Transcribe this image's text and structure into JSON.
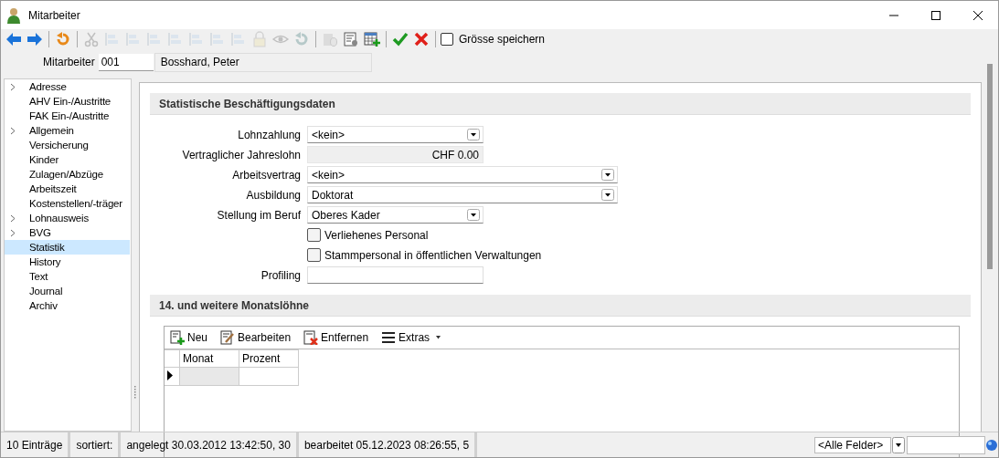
{
  "window": {
    "title": "Mitarbeiter"
  },
  "toolbar": [
    {
      "kind": "back",
      "disabled": false
    },
    {
      "kind": "forward",
      "disabled": false
    },
    {
      "kind": "undo",
      "disabled": false
    },
    {
      "kind": "cut",
      "disabled": true
    },
    {
      "kind": "align",
      "disabled": true
    },
    {
      "kind": "align",
      "disabled": true
    },
    {
      "kind": "align",
      "disabled": true
    },
    {
      "kind": "align",
      "disabled": true
    },
    {
      "kind": "align",
      "disabled": true
    },
    {
      "kind": "align",
      "disabled": true
    },
    {
      "kind": "align",
      "disabled": true
    },
    {
      "kind": "lock",
      "disabled": true
    },
    {
      "kind": "eye",
      "disabled": true
    },
    {
      "kind": "undo",
      "disabled": true
    },
    {
      "kind": "db",
      "disabled": true
    },
    {
      "kind": "form",
      "disabled": false
    },
    {
      "kind": "table",
      "disabled": false
    },
    {
      "kind": "ok",
      "disabled": false
    },
    {
      "kind": "cancel",
      "disabled": false
    }
  ],
  "save_size": {
    "label": "Grösse speichern",
    "checked": false
  },
  "employee": {
    "label": "Mitarbeiter",
    "number": "001",
    "name": "Bosshard, Peter"
  },
  "sidebar": {
    "items": [
      {
        "label": "Adresse",
        "kind": "folder",
        "selected": false
      },
      {
        "label": "AHV Ein-/Austritte",
        "kind": "leaf",
        "selected": false
      },
      {
        "label": "FAK Ein-/Austritte",
        "kind": "leaf",
        "selected": false
      },
      {
        "label": "Allgemein",
        "kind": "folder",
        "selected": false
      },
      {
        "label": "Versicherung",
        "kind": "leaf",
        "selected": false
      },
      {
        "label": "Kinder",
        "kind": "leaf",
        "selected": false
      },
      {
        "label": "Zulagen/Abzüge",
        "kind": "leaf",
        "selected": false
      },
      {
        "label": "Arbeitszeit",
        "kind": "leaf",
        "selected": false
      },
      {
        "label": "Kostenstellen/-träger",
        "kind": "leaf",
        "selected": false
      },
      {
        "label": "Lohnausweis",
        "kind": "folder",
        "selected": false
      },
      {
        "label": "BVG",
        "kind": "folder",
        "selected": false
      },
      {
        "label": "Statistik",
        "kind": "leaf",
        "selected": true
      },
      {
        "label": "History",
        "kind": "leaf",
        "selected": false
      },
      {
        "label": "Text",
        "kind": "leaf",
        "selected": false
      },
      {
        "label": "Journal",
        "kind": "leaf",
        "selected": false
      },
      {
        "label": "Archiv",
        "kind": "leaf",
        "selected": false
      }
    ]
  },
  "section1": {
    "title": "Statistische Beschäftigungsdaten",
    "fields": [
      {
        "kind": "dropdown",
        "label": "Lohnzahlung",
        "value": "<kein>",
        "wide": false
      },
      {
        "kind": "amount",
        "label": "Vertraglicher Jahreslohn",
        "value": "CHF 0.00",
        "wide": false
      },
      {
        "kind": "dropdown",
        "label": "Arbeitsvertrag",
        "value": "<kein>",
        "wide": true
      },
      {
        "kind": "dropdown",
        "label": "Ausbildung",
        "value": "Doktorat",
        "wide": true
      },
      {
        "kind": "dropdown",
        "label": "Stellung im Beruf",
        "value": "Oberes Kader",
        "wide": false
      },
      {
        "kind": "checkbox",
        "label": "Verliehenes Personal",
        "checked": false
      },
      {
        "kind": "checkbox",
        "label": "Stammpersonal in öffentlichen Verwaltungen",
        "checked": false
      },
      {
        "kind": "text",
        "label": "Profiling",
        "wide": false
      }
    ]
  },
  "section2": {
    "title": "14. und weitere Monatslöhne",
    "actions": [
      {
        "kind": "new",
        "label": "Neu"
      },
      {
        "kind": "edit",
        "label": "Bearbeiten"
      },
      {
        "kind": "remove",
        "label": "Entfernen"
      },
      {
        "kind": "menu",
        "label": "Extras"
      }
    ],
    "table": {
      "columns": [
        "Monat",
        "Prozent"
      ],
      "rows": [
        {
          "current": true
        }
      ]
    }
  },
  "status_bar": {
    "count": "10 Einträge",
    "sorted": "sortiert:",
    "created": "angelegt 30.03.2012 13:42:50, 30",
    "edited": "bearbeitet 05.12.2023 08:26:55,  5",
    "filter": "<Alle Felder>"
  }
}
